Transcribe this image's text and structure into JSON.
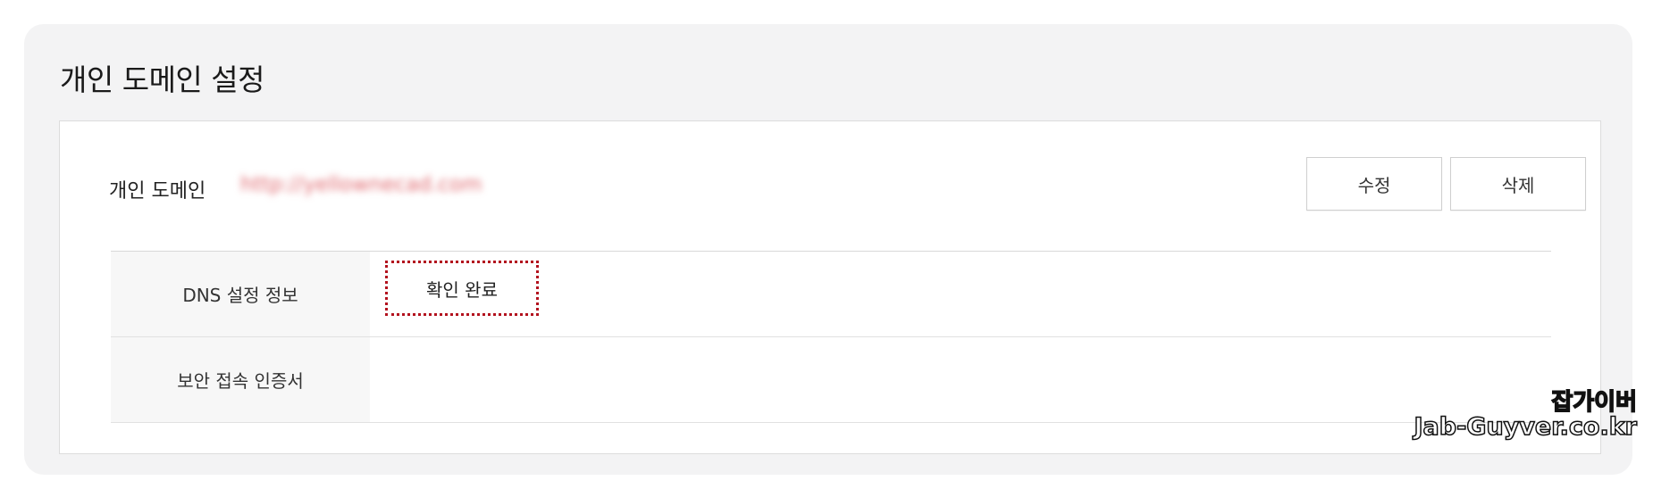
{
  "panel": {
    "title": "개인 도메인 설정"
  },
  "domain": {
    "label": "개인 도메인",
    "value": "http://yellownecad.com"
  },
  "buttons": {
    "edit_label": "수정",
    "delete_label": "삭제"
  },
  "table": {
    "rows": [
      {
        "label": "DNS 설정 정보",
        "value": "확인 완료"
      },
      {
        "label": "보안 접속 인증서",
        "value": ""
      }
    ]
  },
  "watermark": {
    "line1": "잡가이버",
    "line2": "Jab-Guyver.co.kr"
  },
  "colors": {
    "highlight_border": "#b3121e",
    "domain_text": "#e06a70",
    "panel_background": "#f3f3f4"
  }
}
